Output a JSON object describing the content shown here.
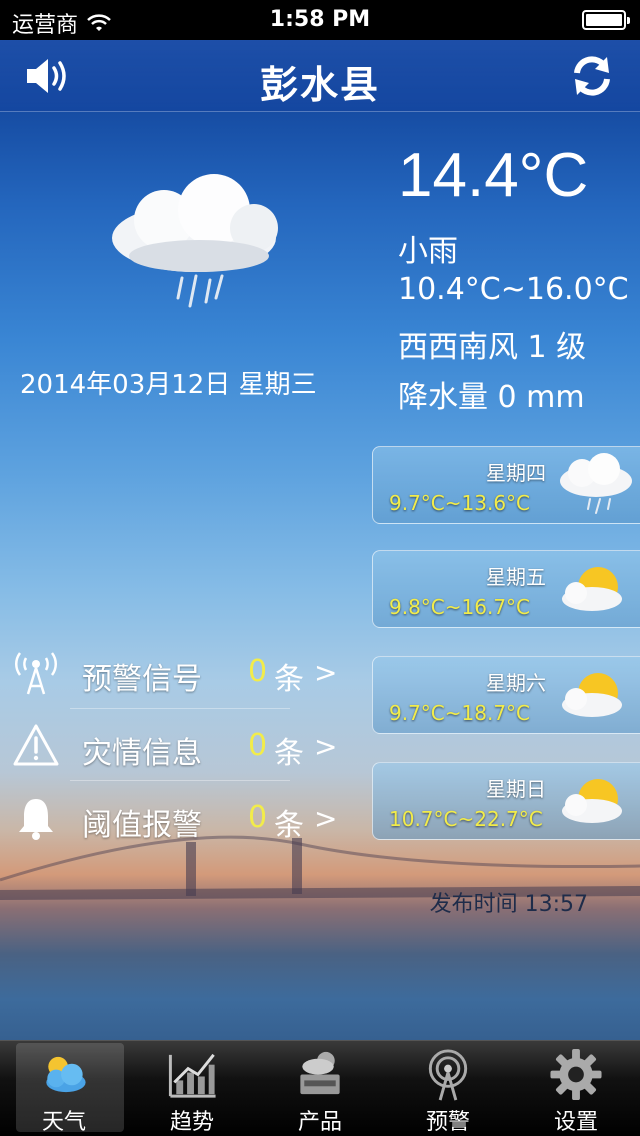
{
  "status": {
    "carrier": "运营商",
    "time": "1:58 PM"
  },
  "nav": {
    "title": "彭水县",
    "left_icon": "speaker-icon",
    "right_icon": "refresh-icon"
  },
  "current": {
    "icon": "cloud-rain-icon",
    "temp": "14.4°C",
    "condition": "小雨",
    "range": "10.4°C~16.0°C",
    "wind": "西西南风 1 级",
    "precip": "降水量 0 mm",
    "date": "2014年03月12日 星期三"
  },
  "forecast": [
    {
      "day": "星期四",
      "range": "9.7°C~13.6°C",
      "icon": "cloud-rain-icon"
    },
    {
      "day": "星期五",
      "range": "9.8°C~16.7°C",
      "icon": "sun-cloud-icon"
    },
    {
      "day": "星期六",
      "range": "9.7°C~18.7°C",
      "icon": "sun-cloud-icon"
    },
    {
      "day": "星期日",
      "range": "10.7°C~22.7°C",
      "icon": "sun-cloud-icon"
    }
  ],
  "alerts": [
    {
      "label": "预警信号",
      "count": "0",
      "unit": "条",
      "arrow": ">",
      "icon": "signal-tower-icon"
    },
    {
      "label": "灾情信息",
      "count": "0",
      "unit": "条",
      "arrow": ">",
      "icon": "warning-triangle-icon"
    },
    {
      "label": "阈值报警",
      "count": "0",
      "unit": "条",
      "arrow": ">",
      "icon": "bell-icon"
    }
  ],
  "publish": "发布时间 13:57",
  "tabs": [
    {
      "label": "天气",
      "icon": "weather-icon",
      "active": true
    },
    {
      "label": "趋势",
      "icon": "trend-chart-icon",
      "active": false
    },
    {
      "label": "产品",
      "icon": "product-icon",
      "active": false
    },
    {
      "label": "预警",
      "icon": "radar-icon",
      "active": false
    },
    {
      "label": "设置",
      "icon": "gear-icon",
      "active": false
    }
  ]
}
